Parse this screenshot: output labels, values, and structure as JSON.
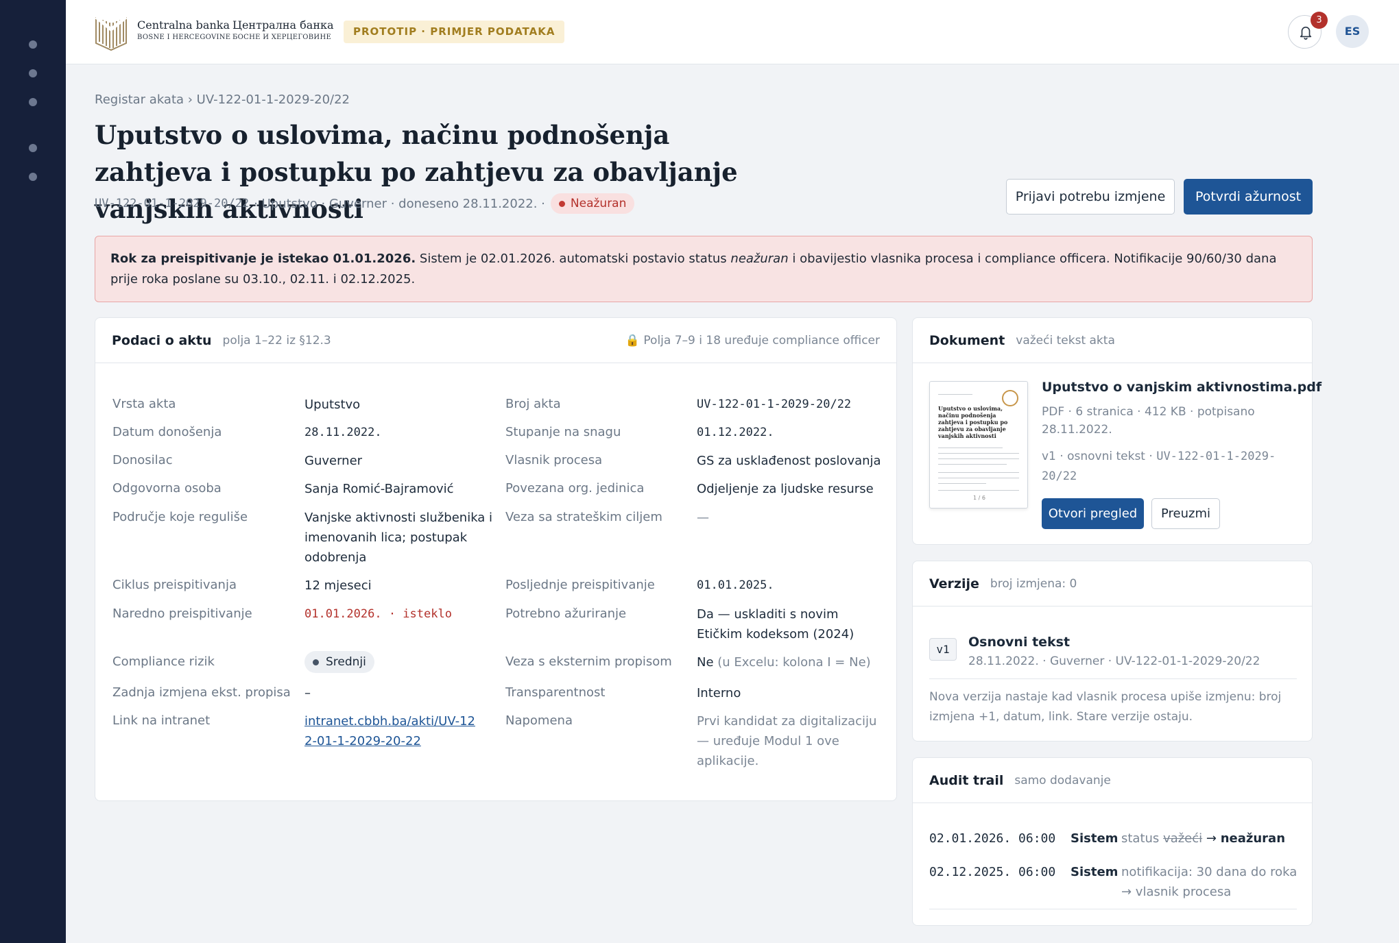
{
  "header": {
    "logo_name_latin": "Centralna banka",
    "logo_sub_latin": "BOSNE I HERCEGOVINE",
    "logo_name_cyrillic": "Централна банка",
    "logo_sub_cyrillic": "БОСНЕ И ХЕРЦЕГОВИНЕ",
    "prototype_badge": "PROTOTIP · PRIMJER PODATAKA",
    "notification_count": "3",
    "avatar_initials": "ES"
  },
  "breadcrumb": "Registar akata › UV-122-01-1-2029-20/22",
  "page": {
    "title": "Uputstvo o uslovima, načinu podnošenja zahtjeva i postupku po zahtjevu za obavljanje vanjskih aktivnosti",
    "meta_code": "UV-122-01-1-2029-20/22",
    "meta_rest": "· Uputstvo · Guverner · doneseno 28.11.2022. ·",
    "status": "Neažuran"
  },
  "actions": {
    "report_change": "Prijavi potrebu izmjene",
    "confirm": "Potvrdi ažurnost"
  },
  "alert": {
    "bold": "Rok za preispitivanje je istekao 01.01.2026.",
    "text_before": "Sistem je 02.01.2026. automatski postavio status",
    "italic": "neažuran",
    "text_after": "i obavijestio vlasnika procesa i compliance officera. Notifikacije 90/60/30 dana prije roka poslane su 03.10., 02.11. i 02.12.2025."
  },
  "details": {
    "title": "Podaci o aktu",
    "subtitle": "polja 1–22 iz §12.3",
    "lock_note": "Polja 7–9 i 18 uređuje compliance officer",
    "rows": [
      {
        "label": "Vrsta akta",
        "value": "Uputstvo",
        "label2": "Broj akta",
        "value2": "UV-122-01-1-2029-20/22"
      },
      {
        "label": "Datum donošenja",
        "value": "28.11.2022.",
        "label2": "Stupanje na snagu",
        "value2": "01.12.2022."
      },
      {
        "label": "Donosilac",
        "value": "Guverner",
        "label2": "Vlasnik procesa",
        "value2": "GS za usklađenost poslovanja"
      },
      {
        "label": "Odgovorna osoba",
        "value": "Sanja Romić-Bajramović",
        "label2": "Povezana org. jedinica",
        "value2": "Odjeljenje za ljudske resurse"
      },
      {
        "label": "Područje koje reguliše",
        "value": "Vanjske aktivnosti službenika i imenovanih lica; postupak odobrenja",
        "label2": "Veza sa strateškim ciljem",
        "value2": "—"
      },
      {
        "label": "Ciklus preispitivanja",
        "value": "12 mjeseci",
        "label2": "Posljednje preispitivanje",
        "value2": "01.01.2025."
      },
      {
        "label": "Naredno preispitivanje",
        "value": "01.01.2026. · isteklo",
        "label2": "Potrebno ažuriranje",
        "value2": "Da — uskladiti s novim Etičkim kodeksom (2024)"
      },
      {
        "label": "Compliance rizik",
        "value": "Srednji",
        "label2": "Veza s eksternim propisom",
        "value2": "Ne",
        "value2_note": "(u Excelu: kolona I = Ne)"
      },
      {
        "label": "Zadnja izmjena ekst. propisa",
        "value": "–",
        "label2": "Transparentnost",
        "value2": "Interno"
      },
      {
        "label": "Link na intranet",
        "value": "intranet.cbbh.ba/akti/UV-122-01-1-2029-20-22",
        "label2": "Napomena",
        "value2": "Prvi kandidat za digitalizaciju — uređuje Modul 1 ove aplikacije."
      }
    ]
  },
  "document": {
    "title": "Dokument",
    "subtitle": "važeći tekst akta",
    "file_name": "Uputstvo o vanjskim aktivnostima.pdf",
    "file_meta": "PDF · 6 stranica · 412 KB · potpisano 28.11.2022.",
    "version_prefix": "v1 · osnovni tekst ·",
    "version_code": "UV-122-01-1-2029-20/22",
    "thumb_title": "Uputstvo o uslovima, načinu podnošenja zahtjeva i postupku po zahtjevu za obavljanje vanjskih aktivnosti",
    "thumb_page": "1 / 6",
    "open_label": "Otvori pregled",
    "download_label": "Preuzmi"
  },
  "versions": {
    "title": "Verzije",
    "subtitle": "broj izmjena: 0",
    "items": [
      {
        "tag": "v1",
        "name": "Osnovni tekst",
        "meta": "28.11.2022. · Guverner · UV-122-01-1-2029-20/22"
      }
    ],
    "note": "Nova verzija nastaje kad vlasnik procesa upiše izmjenu: broj izmjena +1, datum, link. Stare verzije ostaju."
  },
  "audit": {
    "title": "Audit trail",
    "subtitle": "samo dodavanje",
    "items": [
      {
        "time": "02.01.2026. 06:00",
        "actor": "Sistem",
        "pre": "status",
        "old": "važeći",
        "arrow": "→",
        "new": "neažuran"
      },
      {
        "time": "02.12.2025. 06:00",
        "actor": "Sistem",
        "line1": "notifikacija: 30 dana do roka",
        "line2": "→ vlasnik procesa"
      }
    ]
  },
  "colors": {
    "sidebar": "#16203a",
    "primary": "#1e5596",
    "danger": "#b3312b",
    "alert_bg": "#f8e3e3",
    "badge_bg": "#faf0d6"
  }
}
